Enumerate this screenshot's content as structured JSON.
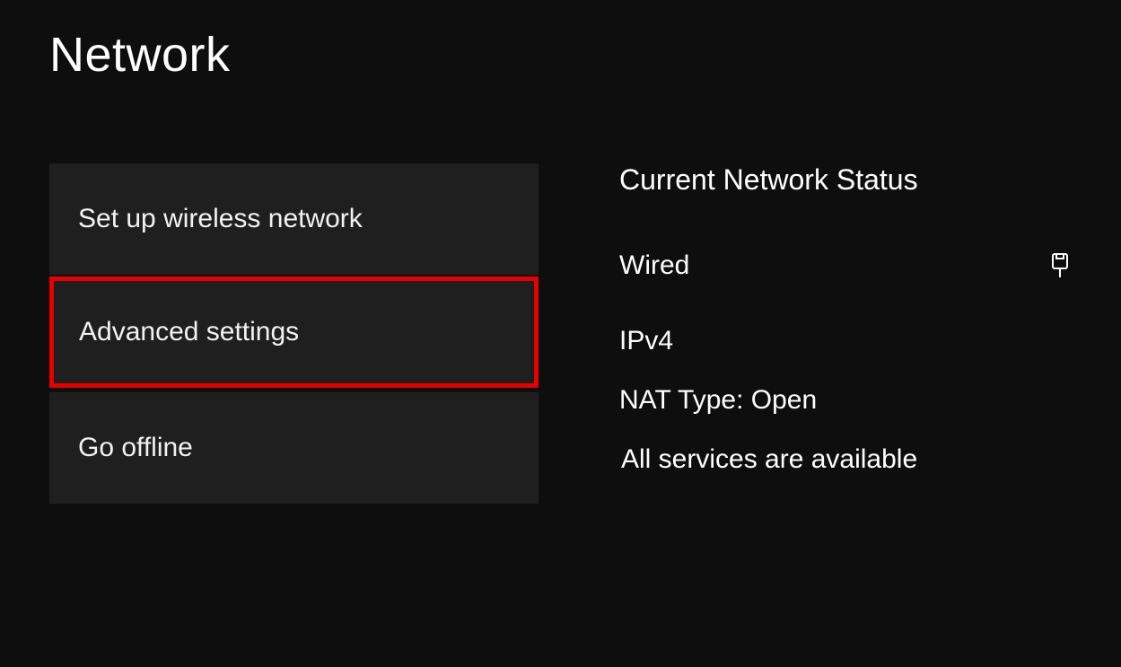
{
  "page_title": "Network",
  "menu": {
    "items": [
      {
        "label": "Set up wireless network",
        "highlighted": false
      },
      {
        "label": "Advanced settings",
        "highlighted": true
      },
      {
        "label": "Go offline",
        "highlighted": false
      }
    ]
  },
  "status": {
    "heading": "Current Network Status",
    "connection_type": "Wired",
    "connection_icon": "ethernet",
    "lines": [
      "IPv4",
      "NAT Type: Open"
    ],
    "services_message": "All services are available"
  },
  "highlight_color": "#e60000"
}
